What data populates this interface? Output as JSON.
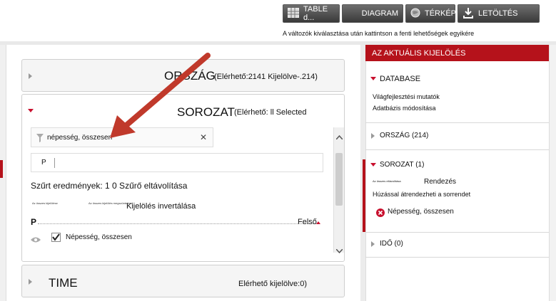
{
  "toolbar": {
    "table_label": "TABLE d...",
    "diagram_label": "DIAGRAM",
    "map_label": "TÉRKÉP",
    "download_label": "LETÖLTÉS",
    "hint": "A változók kiválasztása után kattintson a fenti lehetőségek egyikére"
  },
  "country_panel": {
    "title": "ORSZÁG",
    "stats": "(Elérhető:2141 Kijelölve-.214)"
  },
  "series_panel": {
    "title": "SOROZAT",
    "stats": "(Elérhető: ll Selected",
    "filter_value": "népesség, összesen",
    "clear_icon": "✕",
    "search_value": "P",
    "results_text": "Szűrt eredmények: 1 0 Szűrő eltávolítása",
    "select_all": "Az összes kijelölése",
    "deselect_all": "Az összes kijelölés megszüntetése",
    "invert": "Kijelölés invertálása",
    "group_letter": "P",
    "top_label": "Felső",
    "item_label": "Népesség, összesen"
  },
  "time_panel": {
    "title": "TIME",
    "stats": "Elérhető kijelölve:0)"
  },
  "right_panel": {
    "header": "AZ AKTUÁLIS KIJELÖLÉS",
    "database_label": "DATABASE",
    "db_line1": "Világfejlesztési mutatók",
    "db_line2": "Adatbázis módosítása",
    "country_label": "ORSZÁG (214)",
    "series_label": "SOROZAT (1)",
    "remove_all_small": "Az összes eltávolítása",
    "sort_label": "Rendezés",
    "drag_hint": "Húzással átrendezheti a sorrendet",
    "selected_item": "Népesség, összesen",
    "time_label": "IDŐ (0)"
  },
  "colors": {
    "accent_red": "#b5121b",
    "arrow_red": "#c0392b"
  }
}
